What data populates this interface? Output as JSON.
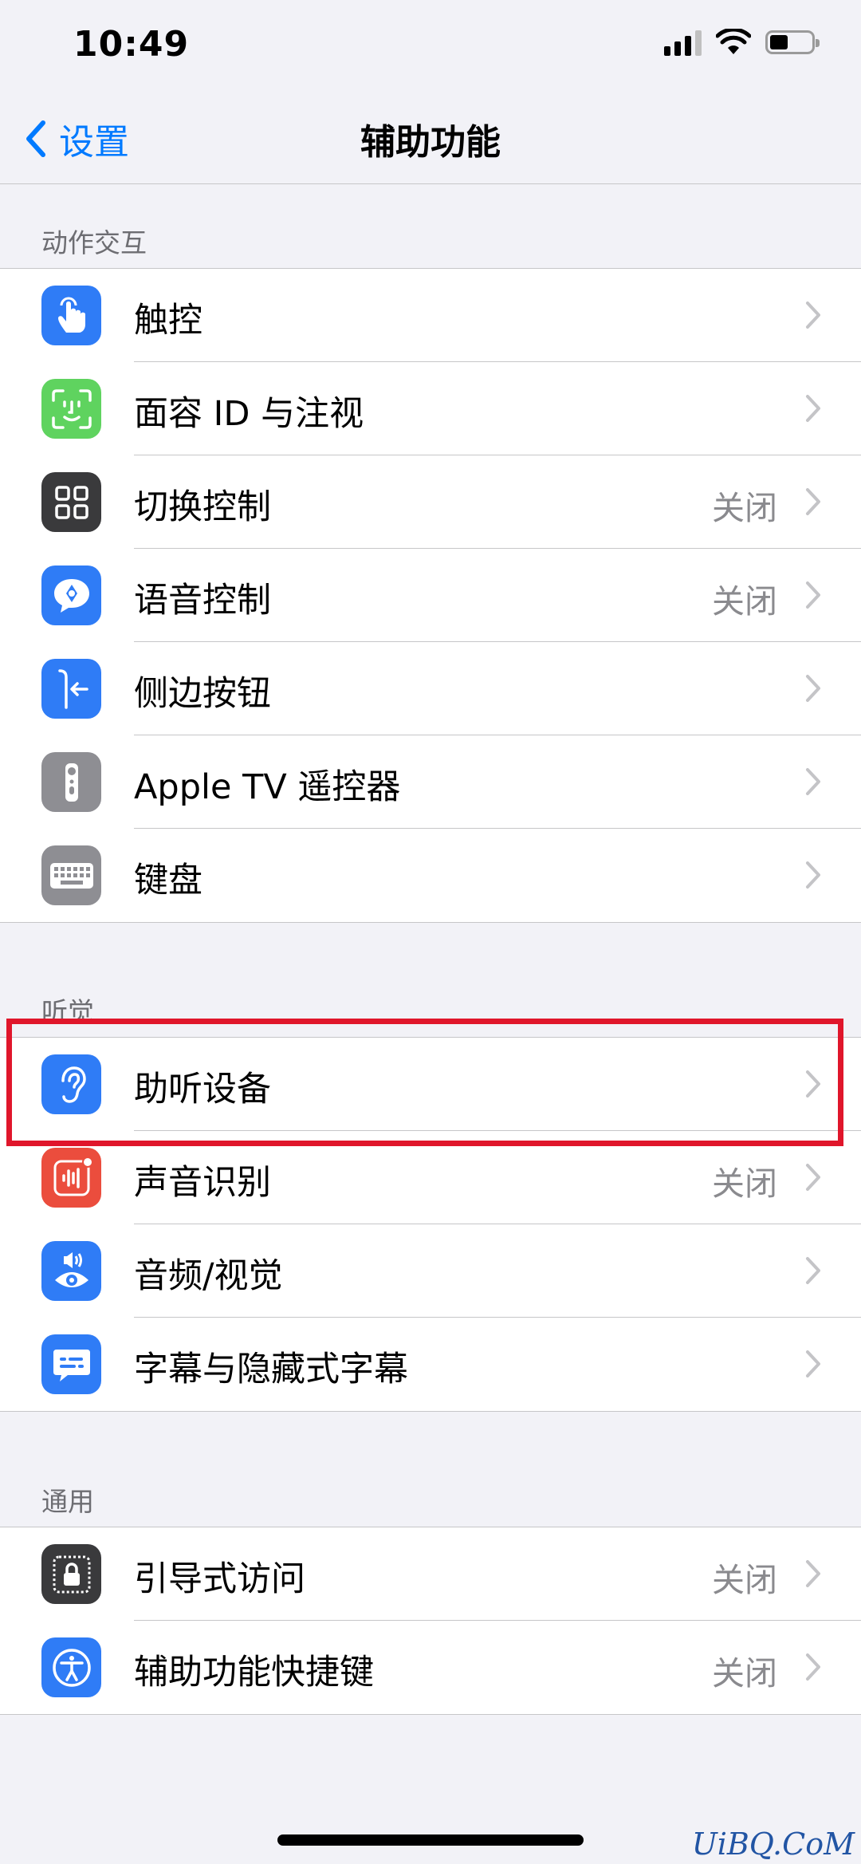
{
  "status_bar": {
    "time": "10:49"
  },
  "nav": {
    "back_label": "设置",
    "title": "辅助功能"
  },
  "sections": [
    {
      "header": "动作交互",
      "items": [
        {
          "label": "触控",
          "value": "",
          "icon": "touch-icon",
          "color": "#2f7cf6"
        },
        {
          "label": "面容 ID 与注视",
          "value": "",
          "icon": "face-id-icon",
          "color": "#5fd35f"
        },
        {
          "label": "切换控制",
          "value": "关闭",
          "icon": "switch-control-icon",
          "color": "#3a3a3c"
        },
        {
          "label": "语音控制",
          "value": "关闭",
          "icon": "voice-control-icon",
          "color": "#2f7cf6"
        },
        {
          "label": "侧边按钮",
          "value": "",
          "icon": "side-button-icon",
          "color": "#2f7cf6"
        },
        {
          "label": "Apple TV 遥控器",
          "value": "",
          "icon": "remote-icon",
          "color": "#8e8e93"
        },
        {
          "label": "键盘",
          "value": "",
          "icon": "keyboard-icon",
          "color": "#8e8e93"
        }
      ]
    },
    {
      "header": "听觉",
      "items": [
        {
          "label": "助听设备",
          "value": "",
          "icon": "ear-icon",
          "color": "#2f7cf6"
        },
        {
          "label": "声音识别",
          "value": "关闭",
          "icon": "sound-recognition-icon",
          "color": "#eb4d3d"
        },
        {
          "label": "音频/视觉",
          "value": "",
          "icon": "audio-visual-icon",
          "color": "#2f7cf6"
        },
        {
          "label": "字幕与隐藏式字幕",
          "value": "",
          "icon": "subtitles-icon",
          "color": "#2f7cf6"
        }
      ]
    },
    {
      "header": "通用",
      "items": [
        {
          "label": "引导式访问",
          "value": "关闭",
          "icon": "guided-access-icon",
          "color": "#3a3a3c"
        },
        {
          "label": "辅助功能快捷键",
          "value": "关闭",
          "icon": "accessibility-icon",
          "color": "#2f7cf6"
        }
      ]
    }
  ],
  "watermark": "UiBQ.CoM"
}
